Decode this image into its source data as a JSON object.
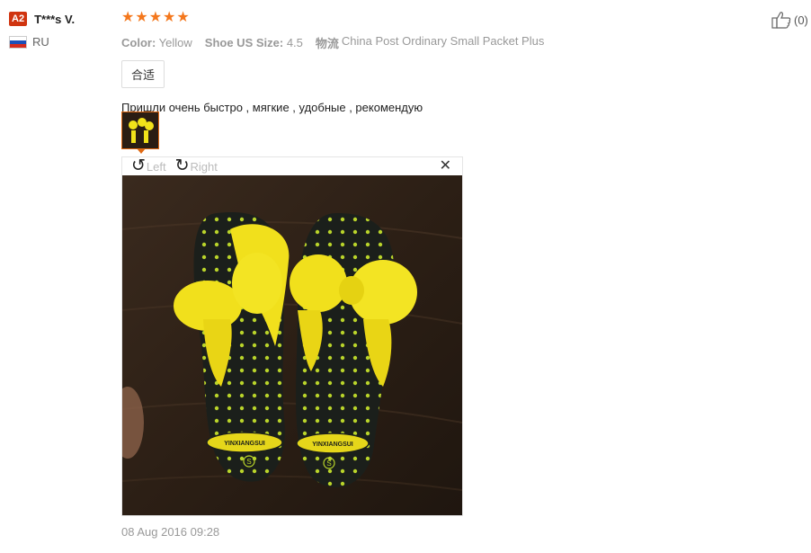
{
  "reviewer": {
    "level_badge": "A2",
    "name": "T***s V.",
    "country_code": "RU",
    "flag_colors": [
      "#ffffff",
      "#1c4fb8",
      "#d52b1e"
    ]
  },
  "review": {
    "rating": 5,
    "stars_shown": [
      "★",
      "★",
      "★",
      "★",
      "★"
    ],
    "star_color": "#f4771c",
    "attributes": [
      {
        "key": "Color:",
        "value": "Yellow"
      },
      {
        "key": "Shoe US Size:",
        "value": "4.5"
      }
    ],
    "shipping": {
      "key": "物流",
      "value": "China Post Ordinary Small Packet Plus"
    },
    "tag_label": "合适",
    "text": "Пришли очень быстро , мягкие , удобные , рекомендую",
    "date": "08 Aug 2016 09:28"
  },
  "viewer": {
    "rotate_left_label": "Left",
    "rotate_right_label": "Right",
    "rotate_left_icon": "rotate-left-icon",
    "rotate_right_icon": "rotate-right-icon",
    "close_icon": "close-icon",
    "photo_text": [
      "YINXIANGSUI",
      "YINXIANGSUI"
    ],
    "size_marks": [
      "S",
      "S"
    ]
  },
  "helpful": {
    "icon": "thumbs-up-icon",
    "count_label": "(0)"
  }
}
